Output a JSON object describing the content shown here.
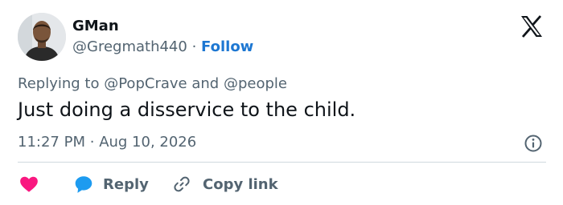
{
  "user": {
    "display_name": "GMan",
    "handle": "@Gregmath440",
    "separator": "·",
    "follow_label": "Follow"
  },
  "brand_logo": "x-logo-icon",
  "reply": {
    "prefix": "Replying to",
    "mention_1": "@PopCrave",
    "conjunction": "and",
    "mention_2": "@people"
  },
  "tweet": {
    "text": "Just doing a disservice to the child.",
    "time": "11:27 PM",
    "separator": "·",
    "date": "Aug 10, 2026"
  },
  "actions": {
    "reply_label": "Reply",
    "copy_link_label": "Copy link"
  },
  "colors": {
    "like": "#f91880",
    "reply_bubble": "#1d9bf0",
    "follow": "#1d77d2",
    "muted": "#536471"
  }
}
